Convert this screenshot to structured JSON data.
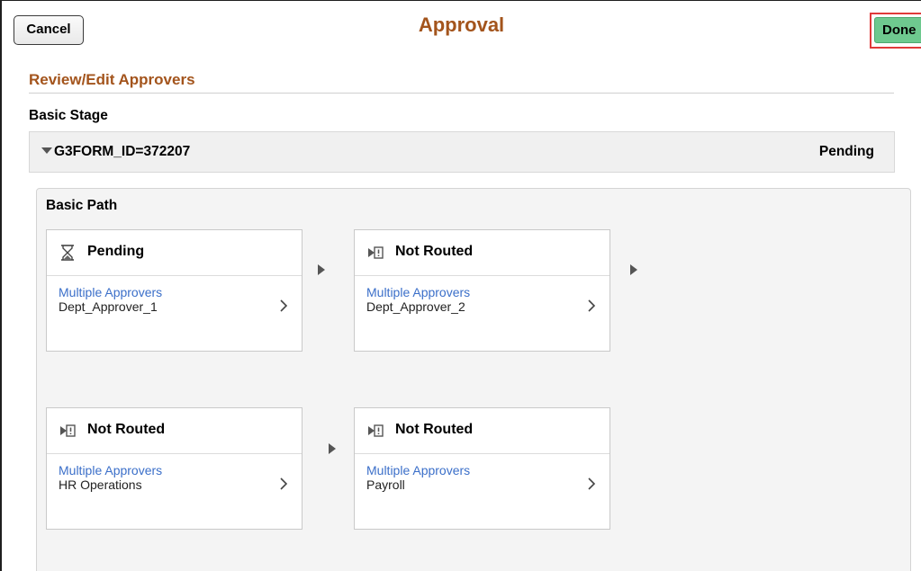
{
  "header": {
    "cancel_label": "Cancel",
    "title": "Approval",
    "done_label": "Done"
  },
  "section": {
    "title": "Review/Edit Approvers"
  },
  "stage": {
    "label": "Basic Stage",
    "form_id": "G3FORM_ID=372207",
    "form_status": "Pending"
  },
  "path": {
    "label": "Basic Path",
    "steps": [
      {
        "status": "Pending",
        "icon": "hourglass-icon",
        "link": "Multiple Approvers",
        "approver": "Dept_Approver_1"
      },
      {
        "status": "Not Routed",
        "icon": "not-routed-icon",
        "link": "Multiple Approvers",
        "approver": "Dept_Approver_2"
      },
      {
        "status": "Not Routed",
        "icon": "not-routed-icon",
        "link": "Multiple Approvers",
        "approver": "HR Operations"
      },
      {
        "status": "Not Routed",
        "icon": "not-routed-icon",
        "link": "Multiple Approvers",
        "approver": "Payroll"
      }
    ]
  },
  "colors": {
    "title": "#a3541c",
    "link": "#3b6fc9",
    "done_bg": "#6ec98f",
    "done_highlight": "#e03a3a"
  }
}
